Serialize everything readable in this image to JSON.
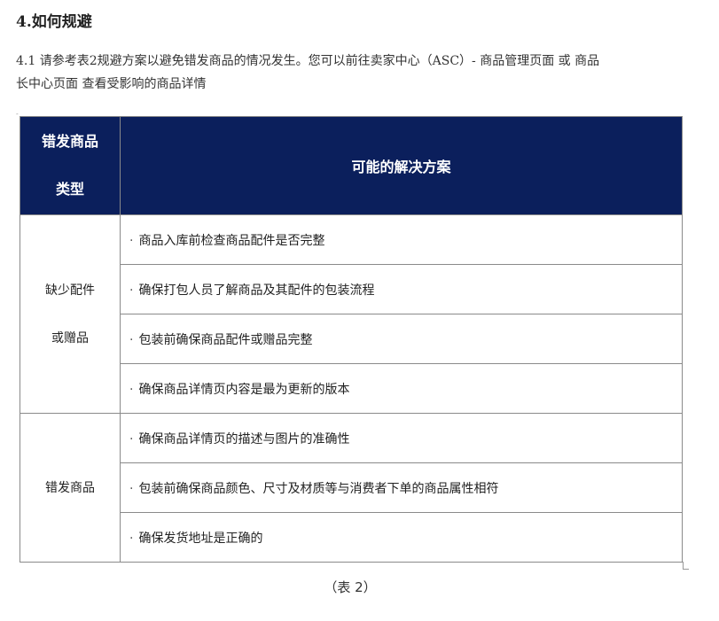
{
  "section": {
    "heading": "4.如何规避",
    "paragraph_line1": "4.1 请参考表2规避方案以避免错发商品的情况发生。您可以前往卖家中心（ASC）- 商品管理页面 或 商品",
    "paragraph_line2": "长中心页面 查看受影响的商品详情"
  },
  "table": {
    "header_type_line1": "错发商品",
    "header_type_line2": "类型",
    "header_solution": "可能的解决方案",
    "bullet": "·",
    "rows": [
      {
        "type_line1": "缺少配件",
        "type_line2": "或赠品",
        "solutions": [
          "商品入库前检查商品配件是否完整",
          "确保打包人员了解商品及其配件的包装流程",
          "包装前确保商品配件或赠品完整",
          "确保商品详情页内容是最为更新的版本"
        ]
      },
      {
        "type_line1": "错发商品",
        "solutions": [
          "确保商品详情页的描述与图片的准确性",
          "包装前确保商品颜色、尺寸及材质等与消费者下单的商品属性相符",
          "确保发货地址是正确的"
        ]
      }
    ]
  },
  "caption": "（表 2）",
  "colors": {
    "header_bg": "#0b1f5c",
    "header_text": "#ffffff",
    "border": "#8a8a8a"
  }
}
